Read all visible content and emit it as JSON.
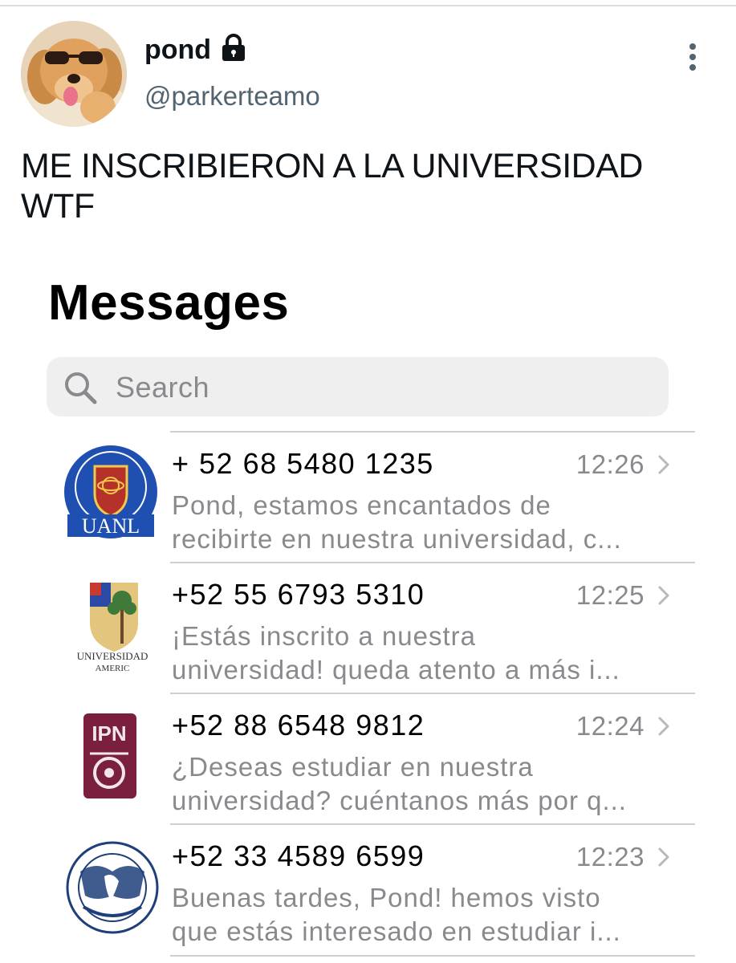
{
  "tweet": {
    "display_name": "pond",
    "handle": "@parkerteamo",
    "text_line1": "ME INSCRIBIERON A LA UNIVERSIDAD",
    "text_line2": "WTF",
    "avatar_icon": "puppy-with-sunglasses-avatar",
    "lock_icon": "lock-icon",
    "more_icon": "more-vertical-icon"
  },
  "messages_screen": {
    "title": "Messages",
    "search": {
      "placeholder": "Search",
      "icon": "search-icon"
    },
    "conversations": [
      {
        "sender": "+ 52 68 5480 1235",
        "time": "12:26",
        "preview_line1": "Pond, estamos encantados de",
        "preview_line2": "recibirte en nuestra universidad, c...",
        "logo": "uanl-seal-logo",
        "logo_text": "UANL"
      },
      {
        "sender": "+52 55 6793 5310",
        "time": "12:25",
        "preview_line1": "¡Estás inscrito a nuestra",
        "preview_line2": "universidad! queda atento a más i...",
        "logo": "universidad-americana-shield-logo",
        "logo_text_1": "UNIVERSIDAD",
        "logo_text_2": "AMERIC"
      },
      {
        "sender": "+52 88 6548 9812",
        "time": "12:24",
        "preview_line1": "¿Deseas estudiar en nuestra",
        "preview_line2": "universidad? cuéntanos más por q...",
        "logo": "ipn-logo",
        "logo_text": "IPN"
      },
      {
        "sender": "+52 33 4589 6599",
        "time": "12:23",
        "preview_line1": "Buenas tardes, Pond! hemos visto",
        "preview_line2": "que estás interesado en estudiar i...",
        "logo": "unam-seal-logo"
      }
    ]
  },
  "colors": {
    "primary_text": "#0f1419",
    "secondary_text": "#536471",
    "ios_gray_text": "#8a8a8e",
    "search_bg": "#efeff0",
    "uanl_blue": "#1f4fb0",
    "ipn_maroon": "#7a1f3d",
    "unam_blue": "#1e3f7a"
  }
}
